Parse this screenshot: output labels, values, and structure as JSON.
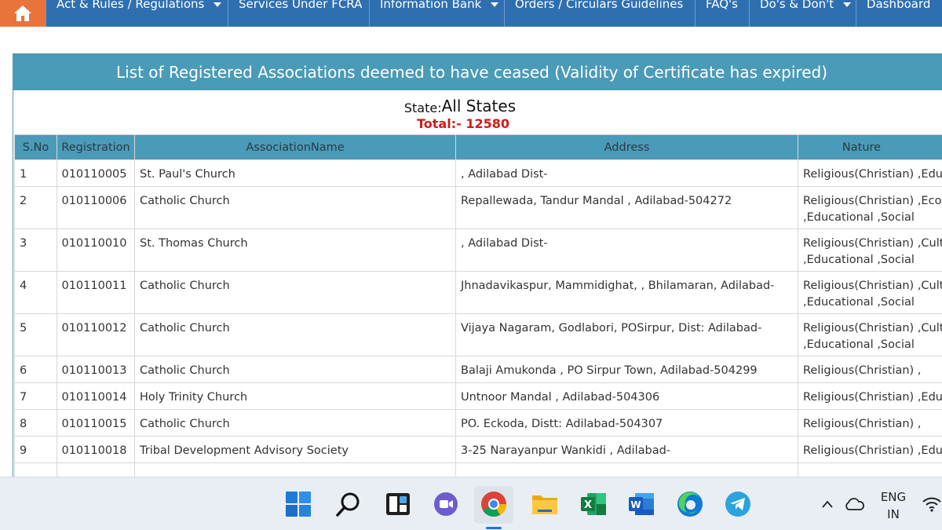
{
  "nav": {
    "items": [
      {
        "label": "Act & Rules / Regulations",
        "dropdown": true
      },
      {
        "label": "Services Under FCRA",
        "dropdown": false
      },
      {
        "label": "Information Bank",
        "dropdown": true
      },
      {
        "label": "Orders / Circulars Guidelines",
        "dropdown": false
      },
      {
        "label": "FAQ's",
        "dropdown": false
      },
      {
        "label": "Do's & Don't",
        "dropdown": true
      },
      {
        "label": "Dashboard",
        "dropdown": false
      }
    ]
  },
  "panel": {
    "title": "List of Registered Associations deemed to have ceased (Validity of Certificate has expired)",
    "state_label": "State:",
    "state_value": "All States",
    "total": "Total:- 12580"
  },
  "table": {
    "headers": [
      "S.No",
      "Registration",
      "AssociationName",
      "Address",
      "Nature"
    ],
    "rows": [
      {
        "sno": "1",
        "reg": "010110005",
        "name": "St. Paul's Church",
        "address": ", Adilabad Dist-",
        "nature1": "Religious(Christian) ,Educational",
        "nature2": ""
      },
      {
        "sno": "2",
        "reg": "010110006",
        "name": "Catholic Church",
        "address": "Repallewada, Tandur Mandal , Adilabad-504272",
        "nature1": "Religious(Christian) ,Economic",
        "nature2": ",Educational ,Social"
      },
      {
        "sno": "3",
        "reg": "010110010",
        "name": "St. Thomas Church",
        "address": ", Adilabad Dist-",
        "nature1": "Religious(Christian) ,Cultural",
        "nature2": ",Educational ,Social"
      },
      {
        "sno": "4",
        "reg": "010110011",
        "name": "Catholic Church",
        "address": "Jhnadavikaspur, Mammidighat, , Bhilamaran, Adilabad-",
        "nature1": "Religious(Christian) ,Cultural",
        "nature2": ",Educational ,Social"
      },
      {
        "sno": "5",
        "reg": "010110012",
        "name": "Catholic Church",
        "address": "Vijaya Nagaram, Godlabori, POSirpur, Dist: Adilabad-",
        "nature1": "Religious(Christian) ,Cultural",
        "nature2": ",Educational ,Social"
      },
      {
        "sno": "6",
        "reg": "010110013",
        "name": "Catholic Church",
        "address": "Balaji Amukonda , PO Sirpur Town, Adilabad-504299",
        "nature1": "Religious(Christian) ,",
        "nature2": ""
      },
      {
        "sno": "7",
        "reg": "010110014",
        "name": "Holy Trinity Church",
        "address": "Untnoor Mandal , Adilabad-504306",
        "nature1": "Religious(Christian) ,Educational",
        "nature2": ""
      },
      {
        "sno": "8",
        "reg": "010110015",
        "name": "Catholic Church",
        "address": "PO. Eckoda, Distt: Adilabad-504307",
        "nature1": "Religious(Christian) ,",
        "nature2": ""
      },
      {
        "sno": "9",
        "reg": "010110018",
        "name": "Tribal Development Advisory Society",
        "address": "3-25 Narayanpur Wankidi , Adilabad-",
        "nature1": "Religious(Christian) ,Educational",
        "nature2": ""
      }
    ]
  },
  "taskbar": {
    "icons": [
      "windows-start-icon",
      "search-icon",
      "task-view-icon",
      "chat-icon",
      "chrome-icon",
      "file-explorer-icon",
      "excel-icon",
      "word-icon",
      "edge-icon",
      "telegram-icon"
    ],
    "tray": {
      "lang_line1": "ENG",
      "lang_line2": "IN"
    }
  },
  "colors": {
    "nav": "#2f6fb0",
    "home": "#e8743b",
    "panel_header": "#4a9bb8",
    "total": "#d11a1a"
  }
}
